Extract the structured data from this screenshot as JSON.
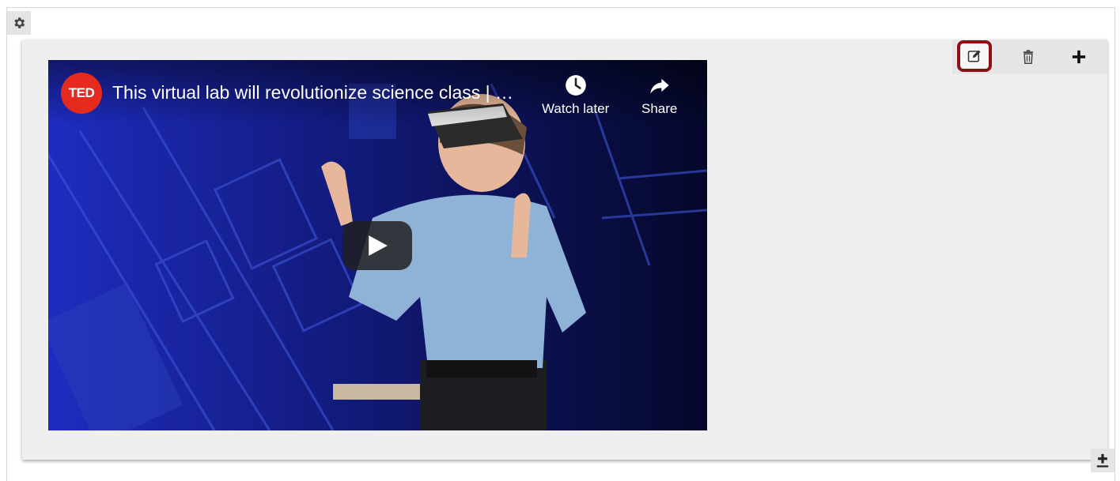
{
  "icons": {
    "settings": "gear-icon",
    "edit": "edit-icon",
    "delete": "trash-icon",
    "add": "plus-icon",
    "add_below": "add-below-icon",
    "watch_later": "clock-icon",
    "share": "share-arrow-icon",
    "play": "play-icon"
  },
  "colors": {
    "highlight": "#8e1014",
    "ted_red": "#e62b1e",
    "panel_bg": "#efefef"
  },
  "video": {
    "logo_text": "TED",
    "title": "This virtual lab will revolutionize science class | …",
    "watch_later_label": "Watch later",
    "share_label": "Share"
  }
}
